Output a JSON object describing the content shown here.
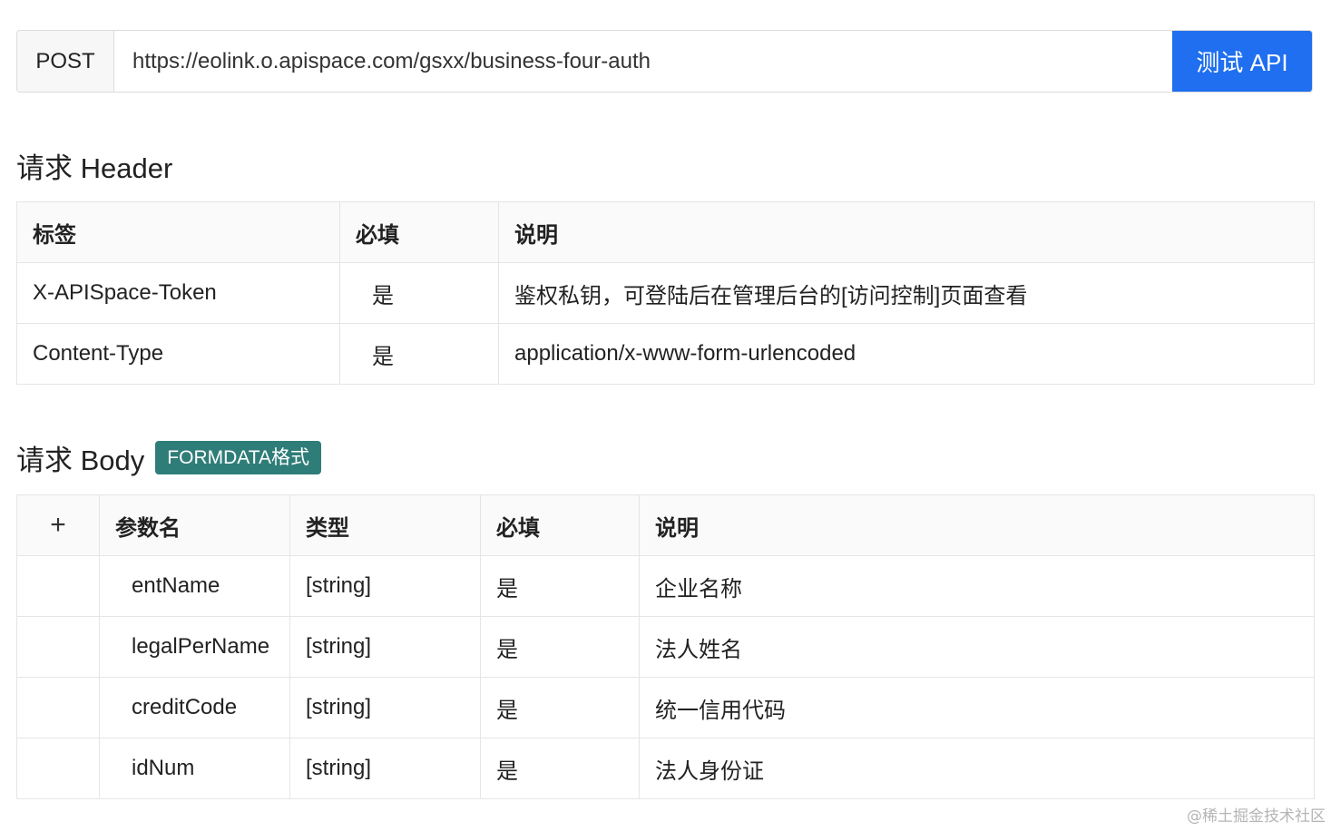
{
  "request": {
    "method": "POST",
    "url": "https://eolink.o.apispace.com/gsxx/business-four-auth",
    "test_button": "测试 API"
  },
  "header_section": {
    "title": "请求 Header",
    "columns": [
      "标签",
      "必填",
      "说明"
    ],
    "rows": [
      {
        "label": "X-APISpace-Token",
        "required": "是",
        "desc": "鉴权私钥，可登陆后在管理后台的[访问控制]页面查看"
      },
      {
        "label": "Content-Type",
        "required": "是",
        "desc": "application/x-www-form-urlencoded"
      }
    ]
  },
  "body_section": {
    "title": "请求 Body",
    "badge": "FORMDATA格式",
    "expand_symbol": "+",
    "columns": [
      "参数名",
      "类型",
      "必填",
      "说明"
    ],
    "rows": [
      {
        "name": "entName",
        "type": "[string]",
        "required": "是",
        "desc": "企业名称"
      },
      {
        "name": "legalPerName",
        "type": "[string]",
        "required": "是",
        "desc": "法人姓名"
      },
      {
        "name": "creditCode",
        "type": "[string]",
        "required": "是",
        "desc": "统一信用代码"
      },
      {
        "name": "idNum",
        "type": "[string]",
        "required": "是",
        "desc": "法人身份证"
      }
    ]
  },
  "watermark": "@稀土掘金技术社区"
}
